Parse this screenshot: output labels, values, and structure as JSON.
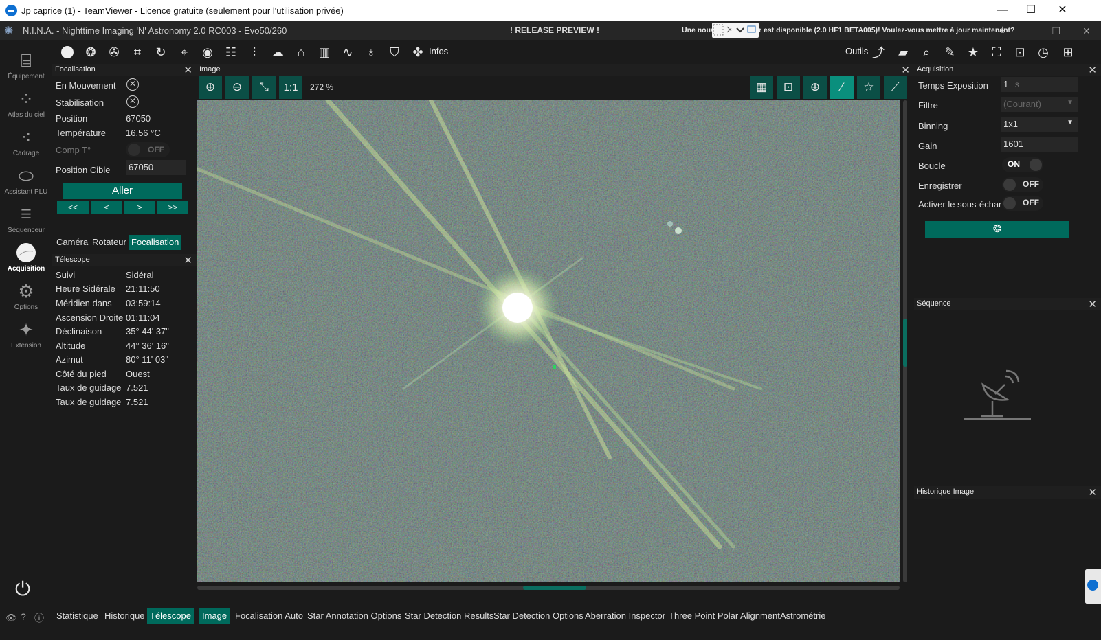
{
  "window": {
    "title": "Jp caprice (1) - TeamViewer - Licence gratuite (seulement pour l'utilisation privée)",
    "minimize": "—",
    "maximize": "☐",
    "close": "✕"
  },
  "app": {
    "title": "N.I.N.A. - Nighttime Imaging 'N' Astronomy 2.0 RC003  -  Evo50/260",
    "release": "! RELEASE PREVIEW !",
    "update_left": "Une nouv",
    "update_right": "r est disponible (2.0 HF1 BETA005)! Voulez-vous mettre à jour maintenant?"
  },
  "sidebar": {
    "items": [
      {
        "label": "Équipement",
        "icon": "telescope-icon"
      },
      {
        "label": "Atlas du ciel",
        "icon": "star-map-icon"
      },
      {
        "label": "Cadrage",
        "icon": "framing-icon"
      },
      {
        "label": "Assistant PLU",
        "icon": "flat-wizard-icon"
      },
      {
        "label": "Séquenceur",
        "icon": "sequencer-icon"
      },
      {
        "label": "Acquisition",
        "icon": "acquisition-icon"
      },
      {
        "label": "Options",
        "icon": "gear-icon"
      },
      {
        "label": "Extension",
        "icon": "puzzle-icon"
      }
    ]
  },
  "toolbar": {
    "infos_label": "Infos",
    "outils_label": "Outils"
  },
  "focuser": {
    "header": "Focalisation",
    "rows": [
      {
        "label": "En Mouvement"
      },
      {
        "label": "Stabilisation"
      }
    ],
    "position_label": "Position",
    "position_value": "67050",
    "temp_label": "Température",
    "temp_value": "16,56 °C",
    "comp_label": "Comp T°",
    "comp_value": "OFF",
    "target_label": "Position Cible",
    "target_value": "67050",
    "go_label": "Aller",
    "steps": [
      "<<",
      "<",
      ">",
      ">>"
    ],
    "tabs": [
      "Caméra",
      "Rotateur",
      "Focalisation"
    ]
  },
  "telescope": {
    "header": "Télescope",
    "rows": [
      {
        "label": "Suivi",
        "value": "Sidéral"
      },
      {
        "label": "Heure Sidérale",
        "value": "21:11:50"
      },
      {
        "label": "Méridien dans",
        "value": "03:59:14"
      },
      {
        "label": "Ascension Droite",
        "value": "01:11:04"
      },
      {
        "label": "Déclinaison",
        "value": "35° 44' 37\""
      },
      {
        "label": "Altitude",
        "value": "44° 36' 16\""
      },
      {
        "label": "Azimut",
        "value": "80° 11' 03\""
      },
      {
        "label": "Côté du pied",
        "value": "Ouest"
      },
      {
        "label": "Taux de guidage er",
        "value": "7.521"
      },
      {
        "label": "Taux de guidage er",
        "value": "7.521"
      }
    ],
    "bottom_tabs": [
      "Statistique",
      "Historique",
      "Télescope"
    ]
  },
  "image": {
    "header": "Image",
    "one_to_one": "1:1",
    "zoom": "272 %",
    "bottom_tabs": [
      "Image",
      "Focalisation Auto",
      "Star Annotation Options",
      "Star Detection Results",
      "Star Detection Options",
      "Aberration Inspector",
      "Three Point Polar Alignment",
      "Astrométrie"
    ]
  },
  "acquisition": {
    "header": "Acquisition",
    "exposure_label": "Temps Exposition",
    "exposure_value": "1",
    "exposure_unit": "s",
    "filter_label": "Filtre",
    "filter_value": "(Courant)",
    "binning_label": "Binning",
    "binning_value": "1x1",
    "gain_label": "Gain",
    "gain_value": "1601",
    "loop_label": "Boucle",
    "loop_value": "ON",
    "save_label": "Enregistrer",
    "save_value": "OFF",
    "subsample_label": "Activer le sous-échant",
    "subsample_value": "OFF"
  },
  "sequence": {
    "header": "Séquence"
  },
  "history": {
    "header": "Historique Image"
  },
  "colors": {
    "accent": "#006a5c",
    "accent_light": "#0a8f7d",
    "bg": "#1b1b1b"
  }
}
